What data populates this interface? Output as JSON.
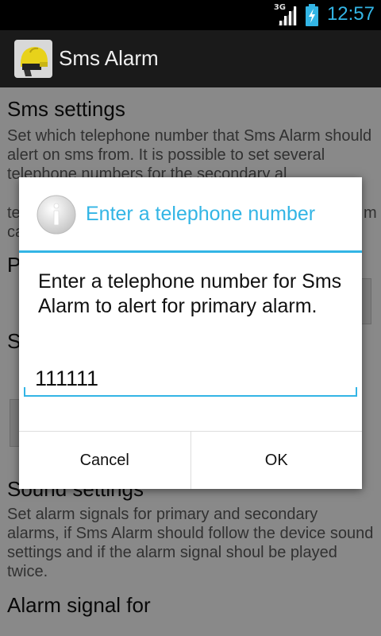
{
  "status_bar": {
    "network": "3G",
    "time": "12:57"
  },
  "action_bar": {
    "title": "Sms Alarm",
    "icon": "fire-helmet-icon"
  },
  "background": {
    "sms_settings": {
      "title": "Sms settings",
      "description": "Set which telephone number that Sms Alarm should alert on sms from. It is possible to set several telephone numbers for the secondary al",
      "desc_frag_1": "te",
      "desc_frag_2": "m",
      "desc_frag_3": "ca"
    },
    "frag_p": "P",
    "frag_s": "S",
    "sound_settings": {
      "title": "Sound settings",
      "description": "Set alarm signals for primary and secondary alarms, if Sms Alarm should follow the device sound settings and if the alarm signal shoul be played twice."
    },
    "alarm_signal": {
      "title": "Alarm signal for"
    }
  },
  "dialog": {
    "icon": "info-icon",
    "title": "Enter a telephone number",
    "message": "Enter a telephone number for Sms Alarm to alert for primary alarm.",
    "input_value": "111111",
    "cancel_label": "Cancel",
    "ok_label": "OK"
  },
  "colors": {
    "accent": "#33b5e5"
  }
}
